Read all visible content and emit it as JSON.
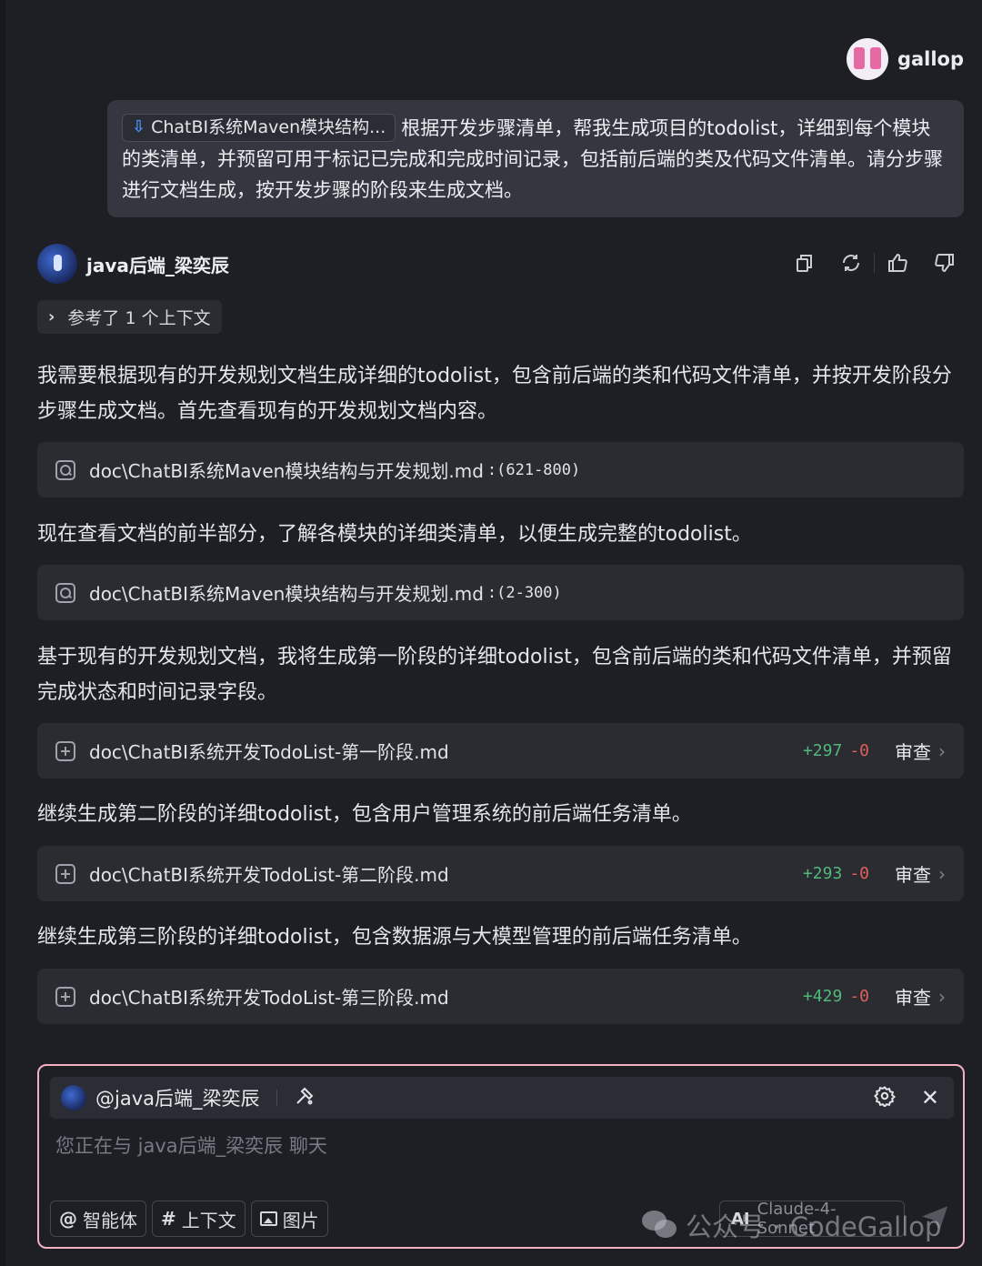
{
  "user": {
    "name": "gallop",
    "context_chip": "ChatBI系统Maven模块结构...",
    "message": "根据开发步骤清单，帮我生成项目的todolist，详细到每个模块的类清单，并预留可用于标记已完成和完成时间记录，包括前后端的类及代码文件清单。请分步骤进行文档生成，按开发步骤的阶段来生成文档。"
  },
  "assistant": {
    "name": "java后端_梁奕辰",
    "references": "参考了 1 个上下文",
    "actions": [
      "copy-icon",
      "refresh-icon",
      "thumbs-up-icon",
      "thumbs-down-icon"
    ],
    "messages": [
      "我需要根据现有的开发规划文档生成详细的todolist，包含前后端的类和代码文件清单，并按开发阶段分步骤生成文档。首先查看现有的开发规划文档内容。",
      "现在查看文档的前半部分，了解各模块的详细类清单，以便生成完整的todolist。",
      "基于现有的开发规划文档，我将生成第一阶段的详细todolist，包含前后端的类和代码文件清单，并预留完成状态和时间记录字段。",
      "继续生成第二阶段的详细todolist，包含用户管理系统的前后端任务清单。",
      "继续生成第三阶段的详细todolist，包含数据源与大模型管理的前后端任务清单。"
    ],
    "reads": [
      {
        "path": "doc\\ChatBI系统Maven模块结构与开发规划.md",
        "range": ":(621-800)"
      },
      {
        "path": "doc\\ChatBI系统Maven模块结构与开发规划.md",
        "range": ":(2-300)"
      }
    ],
    "files": [
      {
        "path": "doc\\ChatBI系统开发TodoList-第一阶段.md",
        "added": "+297",
        "removed": "-0",
        "action": "审查"
      },
      {
        "path": "doc\\ChatBI系统开发TodoList-第二阶段.md",
        "added": "+293",
        "removed": "-0",
        "action": "审查"
      },
      {
        "path": "doc\\ChatBI系统开发TodoList-第三阶段.md",
        "added": "+429",
        "removed": "-0",
        "action": "审查"
      }
    ]
  },
  "input": {
    "agent": "@java后端_梁奕辰",
    "placeholder": "您正在与 java后端_梁奕辰 聊天",
    "tools": {
      "agent": "智能体",
      "context": "上下文",
      "image": "图片"
    },
    "model_prefix": "AI",
    "model": "Claude-4-Sonnet"
  },
  "watermark": "公众号 · CodeGallop",
  "colors": {
    "added": "#52b97b",
    "removed": "#e0605a",
    "input_border": "#f2b1c3"
  }
}
